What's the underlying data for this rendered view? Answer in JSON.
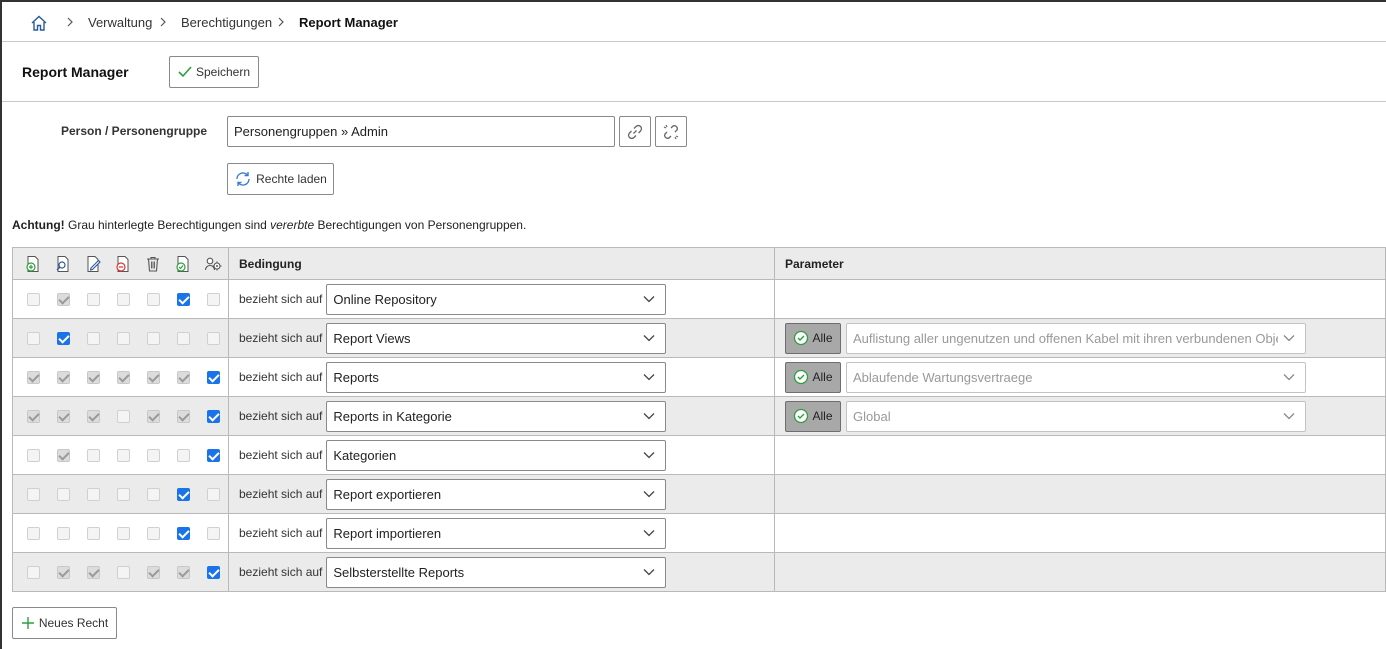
{
  "breadcrumb": {
    "items": [
      "Verwaltung",
      "Berechtigungen"
    ],
    "current": "Report Manager"
  },
  "header": {
    "title": "Report Manager",
    "save_label": "Speichern"
  },
  "form": {
    "person_label": "Person / Personengruppe",
    "person_value": "Personengruppen » Admin",
    "load_rights_label": "Rechte laden"
  },
  "warning": {
    "bold": "Achtung!",
    "part1": " Grau hinterlegte Berechtigungen sind ",
    "italic": "vererbte",
    "part2": " Berechtigungen von Personengruppen."
  },
  "table": {
    "permission_icons": [
      "create-icon",
      "view-icon",
      "edit-icon",
      "archive-icon",
      "delete-icon",
      "execute-icon",
      "supervisor-icon"
    ],
    "header_condition": "Bedingung",
    "header_parameter": "Parameter",
    "condition_prefix": "bezieht sich auf",
    "alle_label": "Alle",
    "rows": [
      {
        "checks": [
          "off",
          "inh",
          "off",
          "off",
          "off",
          "on",
          "off"
        ],
        "condition": "Online Repository",
        "parameter": ""
      },
      {
        "checks": [
          "off",
          "on",
          "off",
          "off",
          "off",
          "off",
          "off"
        ],
        "condition": "Report Views",
        "parameter": "Auflistung aller ungenutzen und offenen Kabel mit ihren verbundenen Objekten"
      },
      {
        "checks": [
          "inh",
          "inh",
          "inh",
          "inh",
          "inh",
          "inh",
          "on"
        ],
        "condition": "Reports",
        "parameter": "Ablaufende Wartungsvertraege"
      },
      {
        "checks": [
          "inh",
          "inh",
          "inh",
          "off",
          "inh",
          "inh",
          "on"
        ],
        "condition": "Reports in Kategorie",
        "parameter": "Global"
      },
      {
        "checks": [
          "off",
          "inh",
          "off",
          "off",
          "off",
          "off",
          "on"
        ],
        "condition": "Kategorien",
        "parameter": ""
      },
      {
        "checks": [
          "off",
          "off",
          "off",
          "off",
          "off",
          "on",
          "off"
        ],
        "condition": "Report exportieren",
        "parameter": ""
      },
      {
        "checks": [
          "off",
          "off",
          "off",
          "off",
          "off",
          "on",
          "off"
        ],
        "condition": "Report importieren",
        "parameter": ""
      },
      {
        "checks": [
          "off",
          "inh",
          "inh",
          "off",
          "inh",
          "inh",
          "on"
        ],
        "condition": "Selbsterstellte Reports",
        "parameter": ""
      }
    ]
  },
  "footer": {
    "new_right_label": "Neues Recht"
  },
  "colors": {
    "accent_blue": "#1a73e8",
    "green_icon": "#2e9e3e",
    "row_gray": "#ebebeb"
  }
}
